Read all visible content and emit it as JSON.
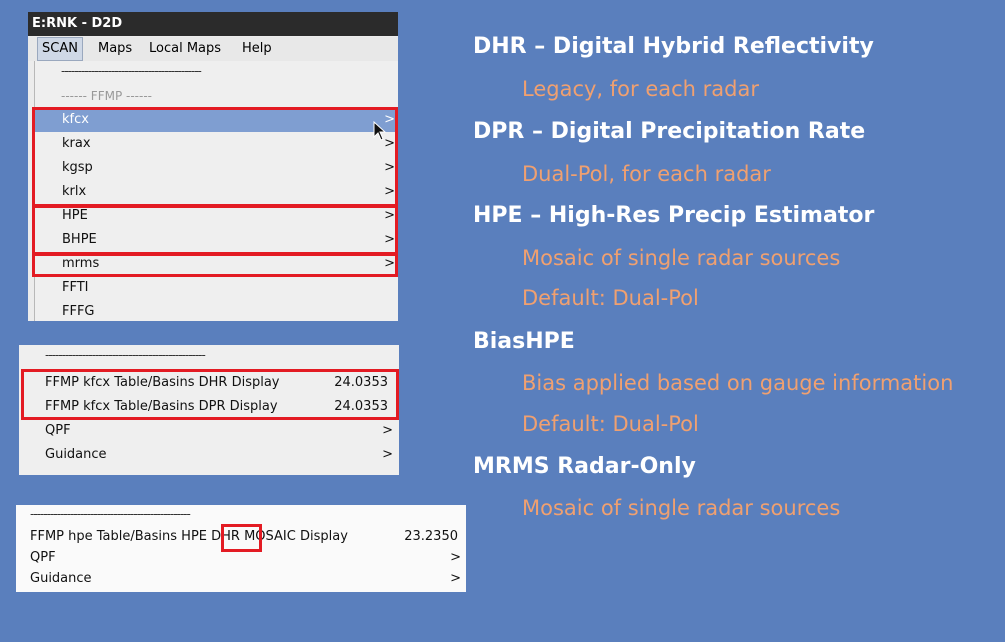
{
  "screenshot1": {
    "title": "E:RNK - D2D",
    "menubar": [
      "SCAN",
      "Maps",
      "Local Maps",
      "Help"
    ],
    "separator": "------------------------------------------",
    "ffmp_label": "------ FFMP ------",
    "items": [
      {
        "label": "kfcx",
        "arrow": ">"
      },
      {
        "label": "krax",
        "arrow": ">"
      },
      {
        "label": "kgsp",
        "arrow": ">"
      },
      {
        "label": "krlx",
        "arrow": ">"
      },
      {
        "label": "HPE",
        "arrow": ">"
      },
      {
        "label": "BHPE",
        "arrow": ">"
      },
      {
        "label": "mrms",
        "arrow": ">"
      },
      {
        "label": "FFTI",
        "arrow": ""
      },
      {
        "label": "FFFG",
        "arrow": ""
      }
    ]
  },
  "screenshot2": {
    "separator": "------------------------------------------------",
    "rows": [
      {
        "label": "FFMP kfcx Table/Basins DHR Display",
        "value": "24.0353"
      },
      {
        "label": "FFMP kfcx Table/Basins DPR Display",
        "value": "24.0353"
      },
      {
        "label": "QPF",
        "arrow": ">"
      },
      {
        "label": "Guidance",
        "arrow": ">"
      }
    ]
  },
  "screenshot3": {
    "separator": "------------------------------------------------",
    "rows": [
      {
        "label": "FFMP hpe Table/Basins HPE DHR MOSAIC Display",
        "value": "23.2350"
      },
      {
        "label": "QPF",
        "arrow": ">"
      },
      {
        "label": "Guidance",
        "arrow": ">"
      }
    ]
  },
  "notes": [
    {
      "heading": "DHR – Digital Hybrid Reflectivity",
      "subs": [
        "Legacy, for each radar"
      ]
    },
    {
      "heading": "DPR – Digital Precipitation Rate",
      "subs": [
        "Dual-Pol, for each radar"
      ]
    },
    {
      "heading": "HPE – High-Res Precip Estimator",
      "subs": [
        "Mosaic of single radar sources",
        "Default: Dual-Pol"
      ]
    },
    {
      "heading": "BiasHPE",
      "subs": [
        "Bias applied based on gauge information",
        "Default: Dual-Pol"
      ]
    },
    {
      "heading": "MRMS Radar-Only",
      "subs": [
        "Mosaic of single radar sources"
      ]
    }
  ],
  "colors": {
    "background": "#5a7fbd",
    "highlight": "#e31b23",
    "heading": "#ffffff",
    "subtext": "#f0a070"
  }
}
